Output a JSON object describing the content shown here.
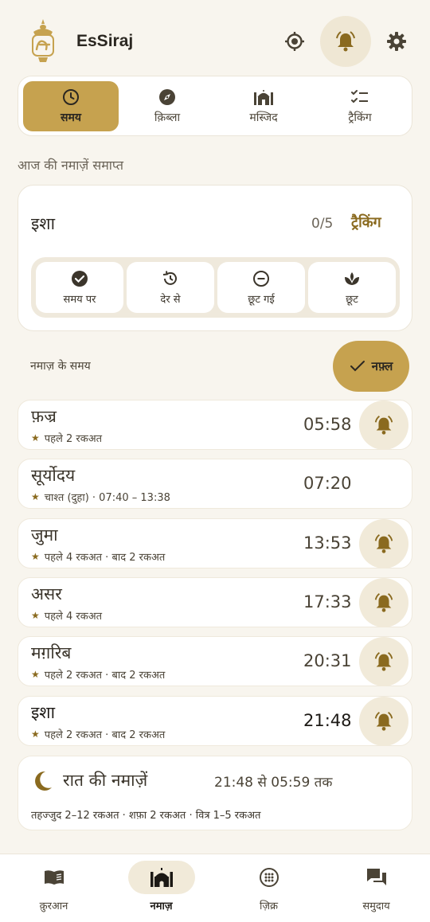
{
  "app": {
    "title": "EsSiraj"
  },
  "colors": {
    "accent": "#c6a24f",
    "accent_dark": "#8a6a1f",
    "bg": "#f8f5ee",
    "chip": "#f1ead9"
  },
  "tabs": [
    {
      "label": "समय",
      "icon": "clock-icon",
      "active": true
    },
    {
      "label": "क़िब्ला",
      "icon": "compass-icon",
      "active": false
    },
    {
      "label": "मस्जिद",
      "icon": "mosque-icon",
      "active": false
    },
    {
      "label": "ट्रैकिंग",
      "icon": "checklist-icon",
      "active": false
    }
  ],
  "status_line": "आज की नमाज़ें समाप्त",
  "next_prayer": {
    "name": "इशा",
    "count": "0/5",
    "tracking_label": "ट्रैकिंग",
    "options": [
      {
        "label": "समय पर",
        "icon": "check-circle-icon"
      },
      {
        "label": "देर से",
        "icon": "history-icon"
      },
      {
        "label": "छूट गई",
        "icon": "minus-circle-icon"
      },
      {
        "label": "छूट",
        "icon": "lotus-icon"
      }
    ]
  },
  "times_section": {
    "label": "नमाज़ के समय",
    "nafl_label": "नफ़्ल"
  },
  "prayers": [
    {
      "name": "फ़ज्र",
      "sub": "पहले 2 रकअत",
      "time": "05:58",
      "bell": true,
      "bold": false
    },
    {
      "name": "सूर्योदय",
      "sub": "चाश्त (दुहा) · 07:40 – 13:38",
      "time": "07:20",
      "bell": false,
      "bold": false
    },
    {
      "name": "जुमा",
      "sub": "पहले 4 रकअत · बाद 2 रकअत",
      "time": "13:53",
      "bell": true,
      "bold": false
    },
    {
      "name": "असर",
      "sub": "पहले 4 रकअत",
      "time": "17:33",
      "bell": true,
      "bold": false
    },
    {
      "name": "मग़रिब",
      "sub": "पहले 2 रकअत · बाद 2 रकअत",
      "time": "20:31",
      "bell": true,
      "bold": false
    },
    {
      "name": "इशा",
      "sub": "पहले 2 रकअत · बाद 2 रकअत",
      "time": "21:48",
      "bell": true,
      "bold": true
    }
  ],
  "night": {
    "title": "रात की नमाज़ें",
    "range": "21:48 से 05:59 तक",
    "sub": "तहज्जुद 2–12 रकअत · शफ़ा 2 रकअत · वित्र 1–5 रकअत"
  },
  "bottom_nav": [
    {
      "label": "क़ुरआन",
      "icon": "book-icon",
      "active": false
    },
    {
      "label": "नमाज़",
      "icon": "mosque-icon",
      "active": true
    },
    {
      "label": "ज़िक्र",
      "icon": "tasbih-icon",
      "active": false
    },
    {
      "label": "समुदाय",
      "icon": "chat-icon",
      "active": false
    }
  ]
}
